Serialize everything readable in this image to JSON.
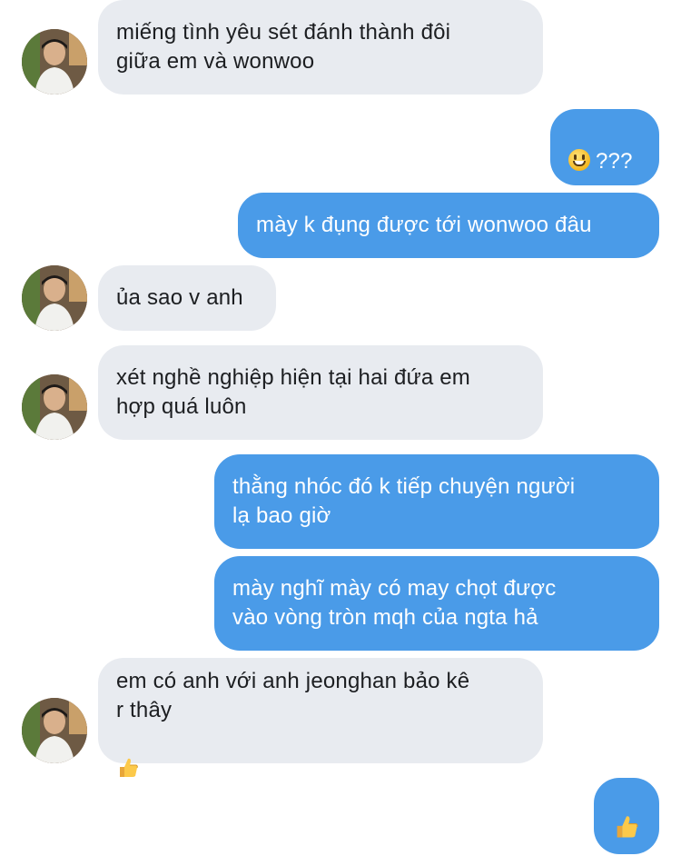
{
  "conversation": {
    "messages": [
      {
        "from": "them",
        "text": "miếng tình yêu sét đánh thành đôi\ngiữa em và wonwoo"
      },
      {
        "from": "me",
        "emoji": "grinning-face-emoji",
        "text": "???"
      },
      {
        "from": "me",
        "text": "mày k đụng được tới wonwoo đâu"
      },
      {
        "from": "them",
        "text": "ủa sao v anh"
      },
      {
        "from": "them",
        "text": "xét nghề nghiệp hiện tại hai đứa em\nhợp quá luôn"
      },
      {
        "from": "me",
        "text": "thằng nhóc đó k tiếp chuyện người\nlạ bao giờ"
      },
      {
        "from": "me",
        "text": "mày nghĩ mày có may chọt được\nvào vòng tròn mqh của ngta hả"
      },
      {
        "from": "them",
        "text": "em có anh với anh jeonghan bảo kê\nr thây",
        "emoji": "thumbs-up-emoji"
      },
      {
        "from": "me",
        "emoji": "thumbs-up-emoji"
      }
    ]
  },
  "colors": {
    "incoming_bubble": "#e8ebf0",
    "outgoing_bubble": "#4a9be8",
    "incoming_text": "#1c1e21",
    "outgoing_text": "#ffffff"
  }
}
